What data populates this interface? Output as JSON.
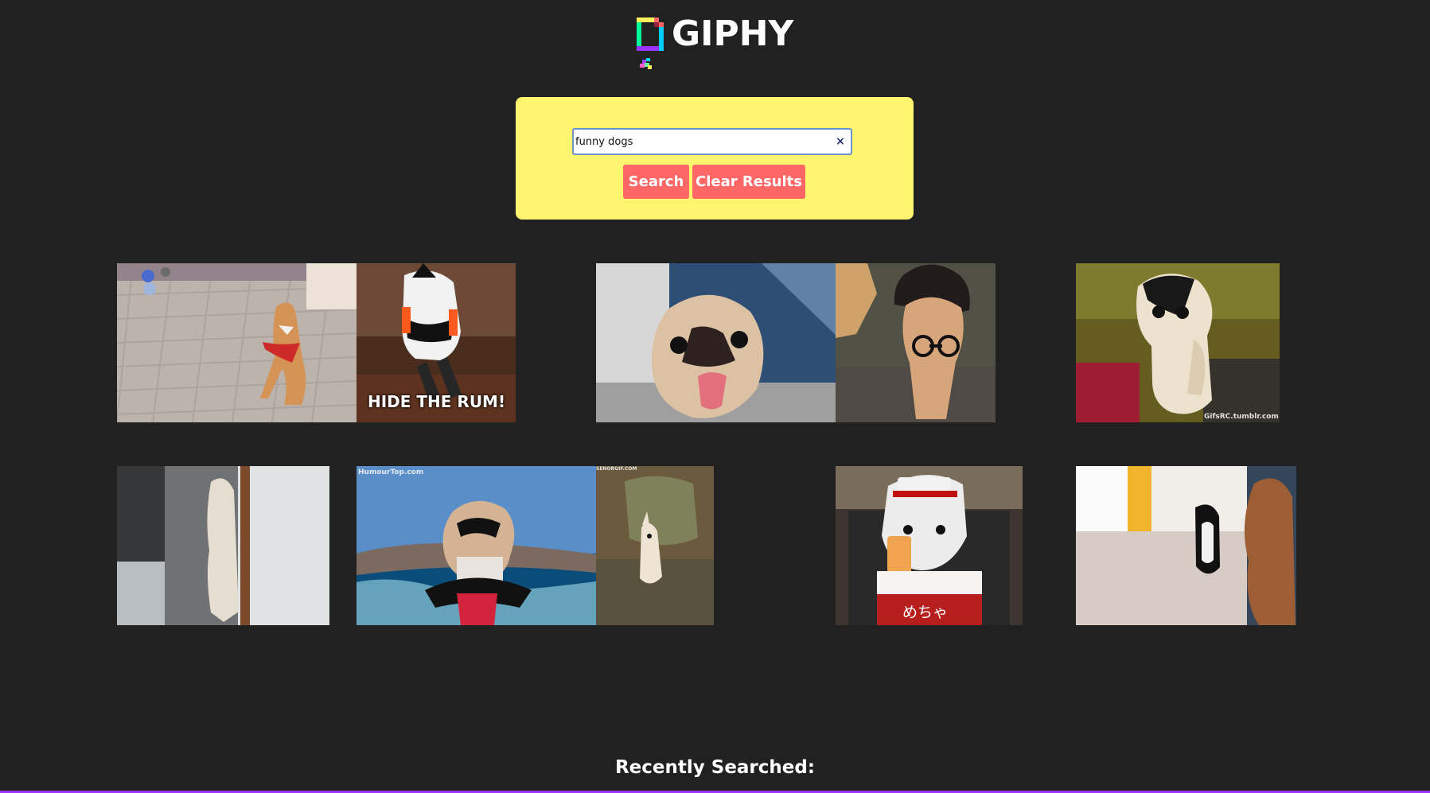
{
  "header": {
    "logo_text": "GIPHY",
    "logo_icon": "giphy-logo-icon",
    "small_icon": "giphy-sticker-icon"
  },
  "search": {
    "query": "funny dogs",
    "clear_input_glyph": "×",
    "search_label": "Search",
    "clear_label": "Clear Results"
  },
  "gifs": [
    {
      "name": "gif-dog-bandana",
      "caption": ""
    },
    {
      "name": "gif-hide-the-rum",
      "caption": "HIDE THE RUM!"
    },
    {
      "name": "gif-pug-closeup",
      "caption": ""
    },
    {
      "name": "gif-boxer-costume",
      "caption": ""
    },
    {
      "name": "gif-boston-terrier",
      "caption": "GifsRC.tumblr.com"
    },
    {
      "name": "gif-dog-behind-door",
      "caption": ""
    },
    {
      "name": "gif-bulldog-jetski",
      "caption": "HumourTop.com"
    },
    {
      "name": "gif-small-dog-sofa",
      "caption": "SENORGIF.COM"
    },
    {
      "name": "gif-french-bulldog-phone",
      "caption": "めちゃ"
    },
    {
      "name": "gif-penguin-and-dog",
      "caption": ""
    }
  ],
  "recent": {
    "title": "Recently Searched:"
  },
  "colors": {
    "background": "#212121",
    "panel": "#fff56f",
    "button": "#ff6666",
    "accent_line": "#9933ff"
  }
}
